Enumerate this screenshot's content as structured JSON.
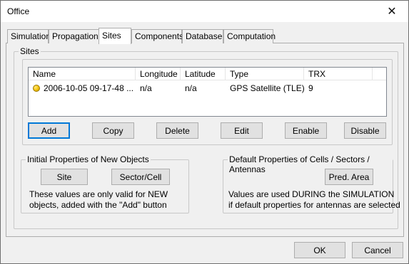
{
  "window": {
    "title": "Office",
    "close_glyph": "✕"
  },
  "tabs": [
    {
      "label": "Simulation",
      "active": false
    },
    {
      "label": "Propagation",
      "active": false
    },
    {
      "label": "Sites",
      "active": true
    },
    {
      "label": "Components",
      "active": false
    },
    {
      "label": "Database",
      "active": false
    },
    {
      "label": "Computation",
      "active": false
    }
  ],
  "sites_group": {
    "label": "Sites"
  },
  "sites_list": {
    "columns": [
      "Name",
      "Longitude",
      "Latitude",
      "Type",
      "TRX"
    ],
    "rows": [
      {
        "status_icon": "yellow-circle-icon",
        "name": "2006-10-05   09-17-48   ...",
        "longitude": "n/a",
        "latitude": "n/a",
        "type": "GPS Satellite (TLE)",
        "trx": "9"
      }
    ]
  },
  "list_buttons": {
    "add": "Add",
    "copy": "Copy",
    "delete": "Delete",
    "edit": "Edit",
    "enable": "Enable",
    "disable": "Disable"
  },
  "initial_properties": {
    "label": "Initial Properties of New Objects",
    "site_button": "Site",
    "sector_cell_button": "Sector/Cell",
    "note_line1": "These values are only valid for     NEW",
    "note_line2": "objects, added with the \"Add\" button"
  },
  "default_properties": {
    "label": "Default Properties of Cells / Sectors / Antennas",
    "pred_area_button": "Pred. Area",
    "note_line1": "Values are used DURING  the SIMULATION",
    "note_line2": "if default properties for antennas are selected"
  },
  "dialog_buttons": {
    "ok": "OK",
    "cancel": "Cancel"
  },
  "colors": {
    "accent": "#0078d7",
    "status_dot": "#f2c200",
    "button_face": "#e1e1e1",
    "dialog_bg": "#f0f0f0"
  }
}
